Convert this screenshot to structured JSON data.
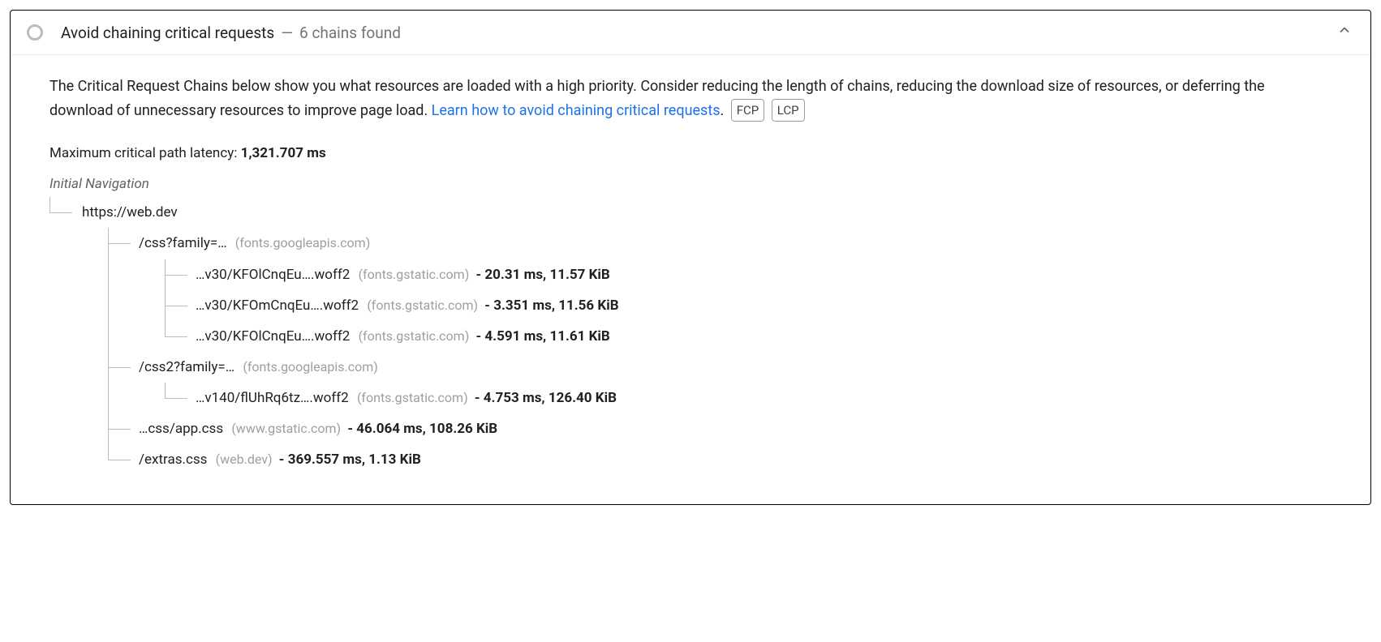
{
  "header": {
    "title": "Avoid chaining critical requests",
    "dash": "—",
    "summary": "6 chains found"
  },
  "description_part1": "The Critical Request Chains below show you what resources are loaded with a high priority. Consider reducing the length of chains, reducing the download size of resources, or deferring the download of unnecessary resources to improve page load. ",
  "link_text": "Learn how to avoid chaining critical requests",
  "period": ".",
  "badges": {
    "fcp": "FCP",
    "lcp": "LCP"
  },
  "latency_label": "Maximum critical path latency: ",
  "latency_value": "1,321.707 ms",
  "root_label": "Initial Navigation",
  "tree": {
    "n0": {
      "url": "https://web.dev"
    },
    "n1": {
      "url": "/css?family=…",
      "host": "(fonts.googleapis.com)"
    },
    "n1a": {
      "url": "…v30/KFOlCnqEu….woff2",
      "host": "(fonts.gstatic.com)",
      "stats": "- 20.31 ms, 11.57 KiB"
    },
    "n1b": {
      "url": "…v30/KFOmCnqEu….woff2",
      "host": "(fonts.gstatic.com)",
      "stats": "- 3.351 ms, 11.56 KiB"
    },
    "n1c": {
      "url": "…v30/KFOlCnqEu….woff2",
      "host": "(fonts.gstatic.com)",
      "stats": "- 4.591 ms, 11.61 KiB"
    },
    "n2": {
      "url": "/css2?family=…",
      "host": "(fonts.googleapis.com)"
    },
    "n2a": {
      "url": "…v140/flUhRq6tz….woff2",
      "host": "(fonts.gstatic.com)",
      "stats": "- 4.753 ms, 126.40 KiB"
    },
    "n3": {
      "url": "…css/app.css",
      "host": "(www.gstatic.com)",
      "stats": "- 46.064 ms, 108.26 KiB"
    },
    "n4": {
      "url": "/extras.css",
      "host": "(web.dev)",
      "stats": "- 369.557 ms, 1.13 KiB"
    }
  }
}
